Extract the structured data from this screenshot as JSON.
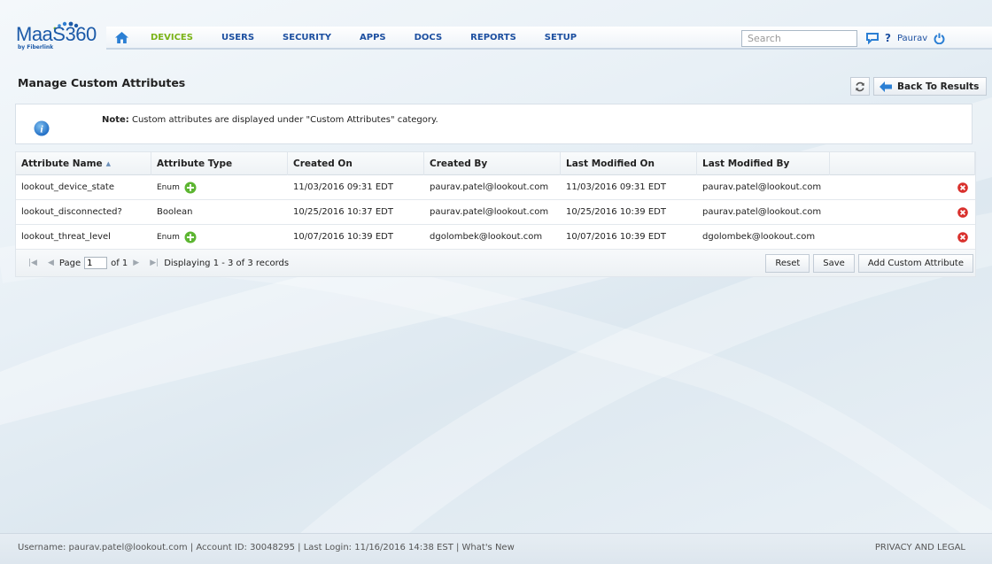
{
  "logo": {
    "text": "MaaS360",
    "sub": "by Fiberlink"
  },
  "nav": {
    "items": [
      {
        "label": "DEVICES",
        "active": true
      },
      {
        "label": "USERS",
        "active": false
      },
      {
        "label": "SECURITY",
        "active": false
      },
      {
        "label": "APPS",
        "active": false
      },
      {
        "label": "DOCS",
        "active": false
      },
      {
        "label": "REPORTS",
        "active": false
      },
      {
        "label": "SETUP",
        "active": false
      }
    ]
  },
  "search": {
    "placeholder": "Search"
  },
  "user": {
    "name": "Paurav"
  },
  "page": {
    "title": "Manage Custom Attributes",
    "back_label": "Back To Results"
  },
  "info": {
    "note_label": "Note:",
    "note_text": " Custom attributes are displayed under \"Custom Attributes\" category."
  },
  "grid": {
    "columns": [
      "Attribute Name",
      "Attribute Type",
      "Created On",
      "Created By",
      "Last Modified On",
      "Last Modified By"
    ],
    "rows": [
      {
        "name": "lookout_device_state",
        "type": "Enum",
        "created_on": "11/03/2016 09:31 EDT",
        "created_by": "paurav.patel@lookout.com",
        "modified_on": "11/03/2016 09:31 EDT",
        "modified_by": "paurav.patel@lookout.com"
      },
      {
        "name": "lookout_disconnected?",
        "type": "Boolean",
        "created_on": "10/25/2016 10:37 EDT",
        "created_by": "paurav.patel@lookout.com",
        "modified_on": "10/25/2016 10:39 EDT",
        "modified_by": "paurav.patel@lookout.com"
      },
      {
        "name": "lookout_threat_level",
        "type": "Enum",
        "created_on": "10/07/2016 10:39 EDT",
        "created_by": "dgolombek@lookout.com",
        "modified_on": "10/07/2016 10:39 EDT",
        "modified_by": "dgolombek@lookout.com"
      }
    ]
  },
  "pager": {
    "page_label": "Page",
    "page_value": "1",
    "of_label": "of 1",
    "display_text": "Displaying 1 - 3 of 3 records"
  },
  "buttons": {
    "reset": "Reset",
    "save": "Save",
    "add": "Add Custom Attribute"
  },
  "footer": {
    "left": "Username:  paurav.patel@lookout.com  | Account ID:  30048295  | Last Login: 11/16/2016 14:38 EST   |  What's New",
    "right": "PRIVACY AND LEGAL"
  },
  "colors": {
    "brand": "#1c4fa0",
    "active_nav": "#7ab317",
    "delete": "#d9302c",
    "add": "#5cb531"
  }
}
